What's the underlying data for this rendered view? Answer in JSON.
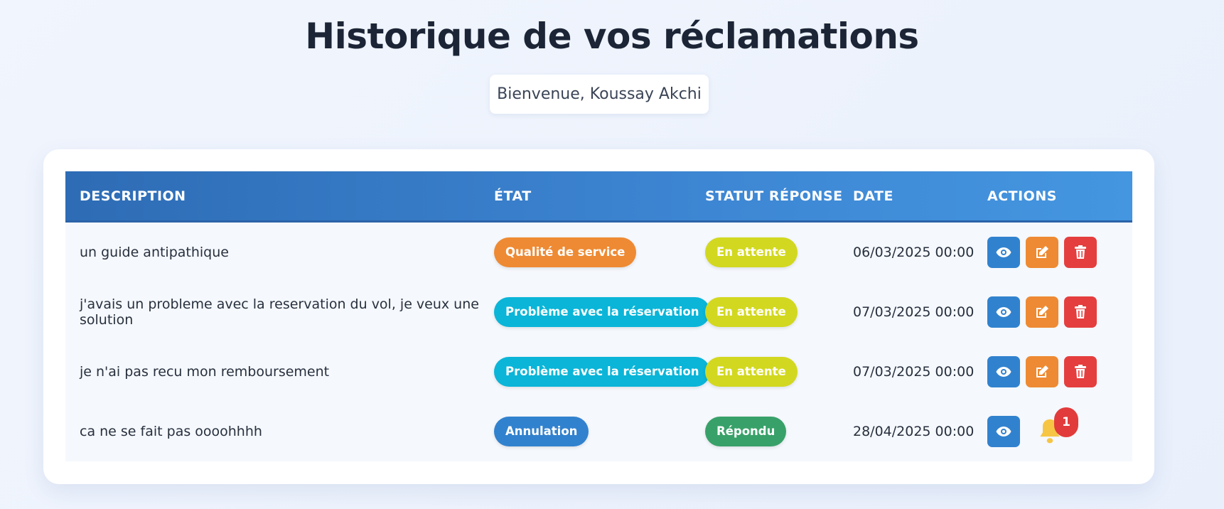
{
  "page": {
    "title": "Historique de vos réclamations",
    "welcome": "Bienvenue, Koussay Akchi"
  },
  "table": {
    "headers": {
      "description": "DESCRIPTION",
      "etat": "ÉTAT",
      "statut": "STATUT RÉPONSE",
      "date": "DATE",
      "actions": "ACTIONS"
    },
    "rows": [
      {
        "description": "un guide antipathique",
        "etat": "Qualité de service",
        "statut": "En attente",
        "date": "06/03/2025 00:00"
      },
      {
        "description": "j'avais un probleme avec la reservation du vol, je veux une solution",
        "etat": "Problème avec la réservation",
        "statut": "En attente",
        "date": "07/03/2025 00:00"
      },
      {
        "description": "je n'ai pas recu mon remboursement",
        "etat": "Problème avec la réservation",
        "statut": "En attente",
        "date": "07/03/2025 00:00"
      },
      {
        "description": "ca ne se fait pas oooohhhh",
        "etat": "Annulation",
        "statut": "Répondu",
        "date": "28/04/2025 00:00",
        "notification_count": "1"
      }
    ]
  },
  "colors": {
    "qualite": "#ee8a33",
    "reservation": "#0ab5d8",
    "annulation": "#3182ce",
    "en_attente": "#d2d81f",
    "repondu": "#38a169",
    "view": "#3182ce",
    "edit": "#ee8a33",
    "delete": "#e53e3e",
    "bell": "#f6c543"
  },
  "icons": [
    "eye-icon",
    "edit-icon",
    "trash-icon",
    "bell-icon"
  ]
}
